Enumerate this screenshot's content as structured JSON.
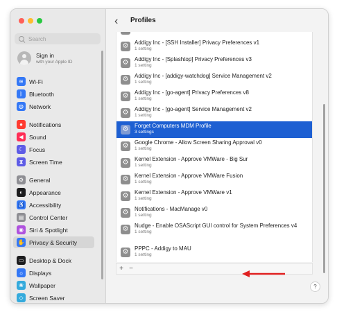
{
  "window": {
    "traffic_lights": {
      "close": "#ff5f57",
      "minimize": "#febc2e",
      "zoom": "#28c840"
    }
  },
  "sidebar": {
    "search_placeholder": "Search",
    "account": {
      "title": "Sign in",
      "subtitle": "with your Apple ID"
    },
    "items": [
      {
        "label": "Wi-Fi",
        "icon": "wifi-icon",
        "color": "#3478f6"
      },
      {
        "label": "Bluetooth",
        "icon": "bluetooth-icon",
        "color": "#3478f6"
      },
      {
        "label": "Network",
        "icon": "globe-icon",
        "color": "#3478f6"
      },
      {
        "label": "Notifications",
        "icon": "bell-icon",
        "color": "#ff3b30"
      },
      {
        "label": "Sound",
        "icon": "speaker-icon",
        "color": "#ff2d55"
      },
      {
        "label": "Focus",
        "icon": "moon-icon",
        "color": "#5e5ce6"
      },
      {
        "label": "Screen Time",
        "icon": "hourglass-icon",
        "color": "#5e5ce6"
      },
      {
        "label": "General",
        "icon": "gear-icon",
        "color": "#8e8e93"
      },
      {
        "label": "Appearance",
        "icon": "appearance-icon",
        "color": "#1c1c1e"
      },
      {
        "label": "Accessibility",
        "icon": "accessibility-icon",
        "color": "#3478f6"
      },
      {
        "label": "Control Center",
        "icon": "control-center-icon",
        "color": "#8e8e93"
      },
      {
        "label": "Siri & Spotlight",
        "icon": "siri-icon",
        "color": "#af52de"
      },
      {
        "label": "Privacy & Security",
        "icon": "hand-icon",
        "color": "#3478f6",
        "active": true
      },
      {
        "label": "Desktop & Dock",
        "icon": "desktop-icon",
        "color": "#1c1c1e"
      },
      {
        "label": "Displays",
        "icon": "display-icon",
        "color": "#3478f6"
      },
      {
        "label": "Wallpaper",
        "icon": "wallpaper-icon",
        "color": "#34aadc"
      },
      {
        "label": "Screen Saver",
        "icon": "screensaver-icon",
        "color": "#34aadc"
      }
    ]
  },
  "main": {
    "back_glyph": "‹",
    "title": "Profiles",
    "profiles": [
      {
        "title": "",
        "subtitle": ""
      },
      {
        "title": "Addigy Inc - [SSH Installer] Privacy Preferences v1",
        "subtitle": "1 setting"
      },
      {
        "title": "Addigy Inc - [Splashtop] Privacy Preferences v3",
        "subtitle": "1 setting"
      },
      {
        "title": "Addigy Inc - [addigy-watchdog] Service Management v2",
        "subtitle": "1 setting"
      },
      {
        "title": "Addigy Inc - [go-agent] Privacy Preferences v8",
        "subtitle": "1 setting"
      },
      {
        "title": "Addigy Inc - [go-agent] Service Management v2",
        "subtitle": "1 setting"
      },
      {
        "title": "Forget Computers MDM Profile",
        "subtitle": "3 settings",
        "selected": true
      },
      {
        "title": "Google Chrome - Allow Screen Sharing Approval v0",
        "subtitle": "1 setting"
      },
      {
        "title": "Kernel Extension - Approve VMWare - Big Sur",
        "subtitle": "1 setting"
      },
      {
        "title": "Kernel Extension - Approve VMWare Fusion",
        "subtitle": "1 setting"
      },
      {
        "title": "Kernel Extension - Approve VMWare v1",
        "subtitle": "1 setting"
      },
      {
        "title": "Notifications - MacManage v0",
        "subtitle": "1 setting"
      },
      {
        "title": "Nudge - Enable OSAScript GUI control for System Preferences v4",
        "subtitle": "1 setting"
      },
      {
        "title": "PPPC - Addigy to MAU",
        "subtitle": "1 setting"
      },
      {
        "title": "",
        "subtitle": ""
      }
    ],
    "add_label": "+",
    "remove_label": "−",
    "help_label": "?",
    "annotation_arrow_color": "#e02020"
  }
}
